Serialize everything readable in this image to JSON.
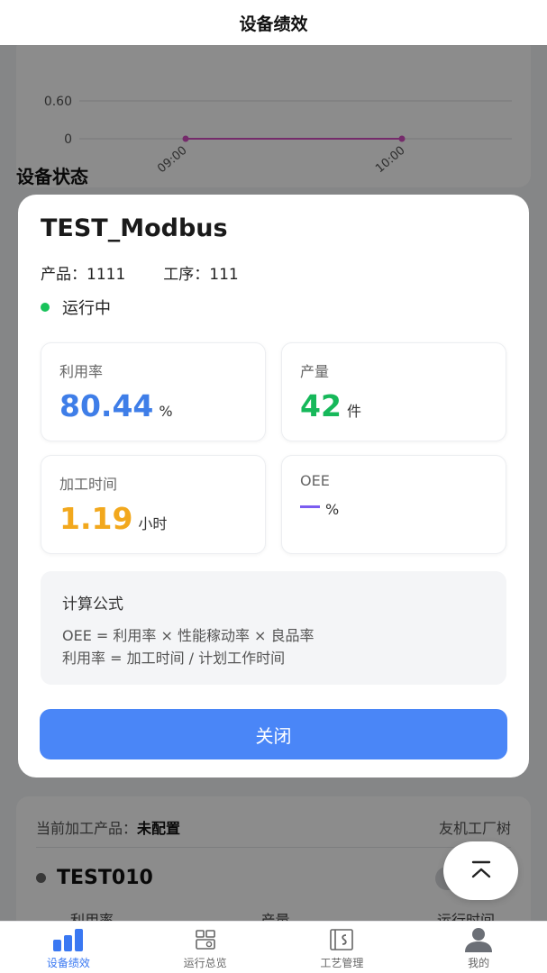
{
  "header": {
    "title": "设备绩效"
  },
  "background": {
    "chart": {
      "y_ticks": [
        "0.60",
        "0"
      ],
      "x_ticks": [
        "09:00",
        "10:00"
      ],
      "line_color": "#d64fc4",
      "chart_data": {
        "type": "line",
        "categories": [
          "09:00",
          "10:00"
        ],
        "values": [
          0,
          0
        ],
        "ylim": [
          0,
          0.6
        ]
      }
    },
    "section_title": "设备状态",
    "lower_card": {
      "current_label": "当前加工产品：",
      "current_value": "未配置",
      "right_text": "友机工厂树",
      "device_name": "TEST010",
      "label_utilization": "利用率",
      "label_output": "产量",
      "label_runtime": "运行时间"
    }
  },
  "modal": {
    "title": "TEST_Modbus",
    "product_label": "产品：",
    "product_value": "1111",
    "process_label": "工序：",
    "process_value": "111",
    "status": "运行中",
    "status_color": "#18c25a",
    "stats": {
      "utilization": {
        "label": "利用率",
        "value": "80.44",
        "unit": "%",
        "color": "#3f7ee8"
      },
      "output": {
        "label": "产量",
        "value": "42",
        "unit": "件",
        "color": "#16b85a"
      },
      "machining_time": {
        "label": "加工时间",
        "value": "1.19",
        "unit": "小时",
        "color": "#f2a81d"
      },
      "oee": {
        "label": "OEE",
        "unit": "%",
        "color": "#7b5cf0"
      }
    },
    "formula": {
      "title": "计算公式",
      "line1": "OEE = 利用率 × 性能稼动率 × 良品率",
      "line2": "利用率 = 加工时间 / 计划工作时间"
    },
    "close_label": "关闭",
    "close_color": "#4a86f7"
  },
  "nav": {
    "items": [
      {
        "label": "设备绩效",
        "icon": "bar-chart-icon",
        "active": true
      },
      {
        "label": "运行总览",
        "icon": "overview-icon",
        "active": false
      },
      {
        "label": "工艺管理",
        "icon": "process-icon",
        "active": false
      },
      {
        "label": "我的",
        "icon": "user-icon",
        "active": false
      }
    ],
    "active_color": "#3a78f2"
  }
}
